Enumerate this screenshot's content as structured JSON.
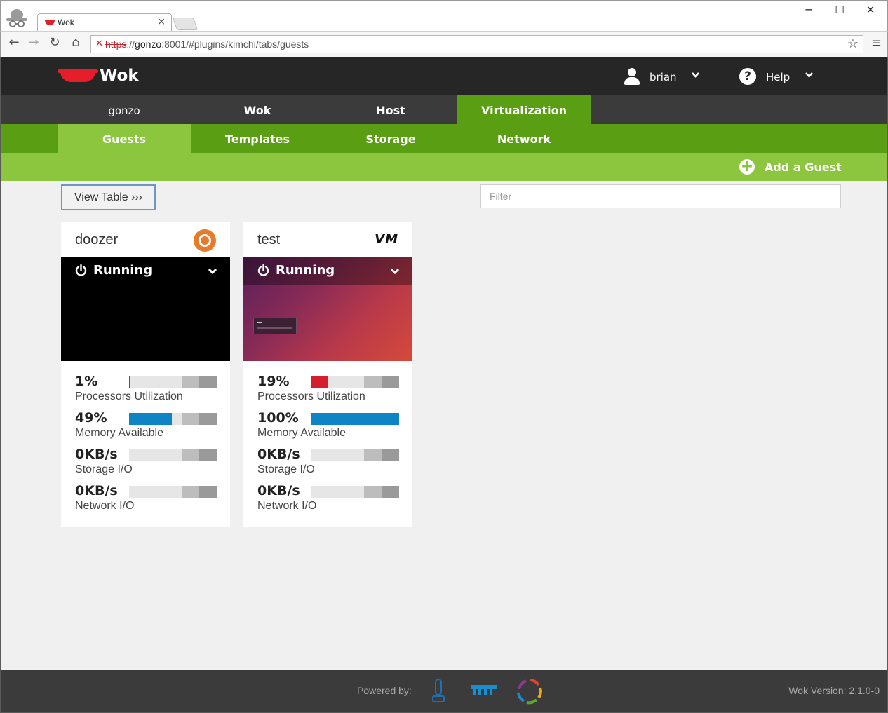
{
  "browser": {
    "tab_title": "Wok",
    "tab_close": "×",
    "url_protocol": "https",
    "url_rest": "://",
    "url_host": "gonzo",
    "url_path": ":8001/#plugins/kimchi/tabs/guests",
    "window_minimize": "─",
    "window_maximize": "☐",
    "window_close": "✕"
  },
  "header": {
    "brand": "Wok",
    "user": "brian",
    "help": "Help"
  },
  "top_nav": [
    "gonzo",
    "Wok",
    "Host",
    "Virtualization"
  ],
  "sub_nav": [
    "Guests",
    "Templates",
    "Storage",
    "Network"
  ],
  "actions": {
    "add_guest": "Add a Guest",
    "view_table": "View Table ›››",
    "filter_placeholder": "Filter"
  },
  "guests": [
    {
      "name": "doozer",
      "os_icon": "ubuntu-icon",
      "status": "Running",
      "stats": {
        "cpu": {
          "value": "1%",
          "label": "Processors Utilization",
          "percent": 1
        },
        "memory": {
          "value": "49%",
          "label": "Memory Available",
          "percent": 49
        },
        "storage": {
          "value": "0KB/s",
          "label": "Storage I/O",
          "percent": 0
        },
        "network": {
          "value": "0KB/s",
          "label": "Network I/O",
          "percent": 0
        }
      }
    },
    {
      "name": "test",
      "os_icon": "vm-icon",
      "os_badge": "VM",
      "status": "Running",
      "stats": {
        "cpu": {
          "value": "19%",
          "label": "Processors Utilization",
          "percent": 19
        },
        "memory": {
          "value": "100%",
          "label": "Memory Available",
          "percent": 100
        },
        "storage": {
          "value": "0KB/s",
          "label": "Storage I/O",
          "percent": 0
        },
        "network": {
          "value": "0KB/s",
          "label": "Network I/O",
          "percent": 0
        }
      }
    }
  ],
  "footer": {
    "powered_by": "Powered by:",
    "version": "Wok Version: 2.1.0-0"
  },
  "colors": {
    "header_bg": "#262626",
    "nav_bg": "#3b3b3b",
    "green_dark": "#5a9e13",
    "green_light": "#8cc63f",
    "cpu_fill": "#d51f2e",
    "memory_fill": "#0d84c4",
    "brand_red": "#e41f2b"
  }
}
